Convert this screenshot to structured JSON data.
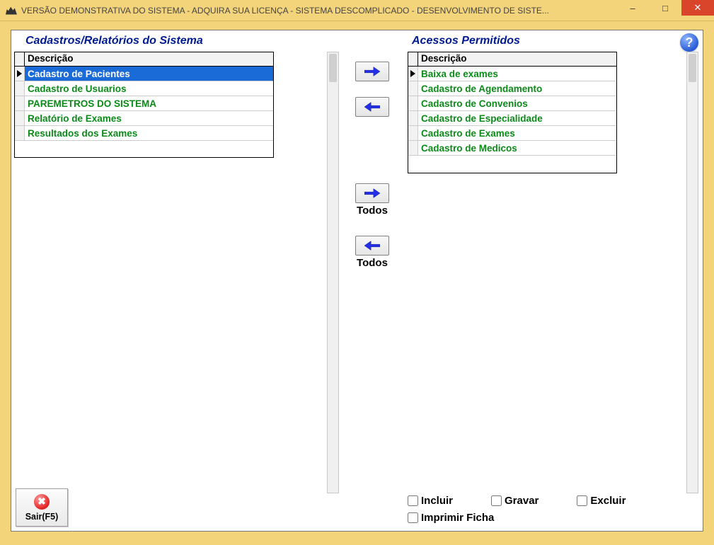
{
  "window": {
    "title": "VERSÃO DEMONSTRATIVA DO SISTEMA - ADQUIRA SUA LICENÇA - SISTEMA DESCOMPLICADO - DESENVOLVIMENTO DE SISTE..."
  },
  "headings": {
    "left": "Cadastros/Relatórios do Sistema",
    "right": "Acessos Permitidos"
  },
  "grid": {
    "column_header": "Descrição"
  },
  "left_grid": {
    "rows": [
      {
        "label": "Cadastro de Pacientes",
        "selected": true,
        "current": true
      },
      {
        "label": "Cadastro de Usuarios",
        "selected": false,
        "current": false
      },
      {
        "label": "PAREMETROS DO SISTEMA",
        "selected": false,
        "current": false
      },
      {
        "label": "Relatório de Exames",
        "selected": false,
        "current": false
      },
      {
        "label": "Resultados dos Exames",
        "selected": false,
        "current": false
      }
    ]
  },
  "right_grid": {
    "rows": [
      {
        "label": "Baixa de exames",
        "selected": false,
        "current": true
      },
      {
        "label": "Cadastro de Agendamento",
        "selected": false,
        "current": false
      },
      {
        "label": "Cadastro de Convenios",
        "selected": false,
        "current": false
      },
      {
        "label": "Cadastro de Especialidade",
        "selected": false,
        "current": false
      },
      {
        "label": "Cadastro de Exames",
        "selected": false,
        "current": false
      },
      {
        "label": "Cadastro de Medicos",
        "selected": false,
        "current": false
      }
    ]
  },
  "buttons": {
    "move_right": ">",
    "move_left": "<",
    "all_label": "Todos",
    "sair": "Sair(F5)"
  },
  "options": {
    "incluir": "Incluir",
    "gravar": "Gravar",
    "excluir": "Excluir",
    "imprimir_ficha": "Imprimir Ficha"
  }
}
